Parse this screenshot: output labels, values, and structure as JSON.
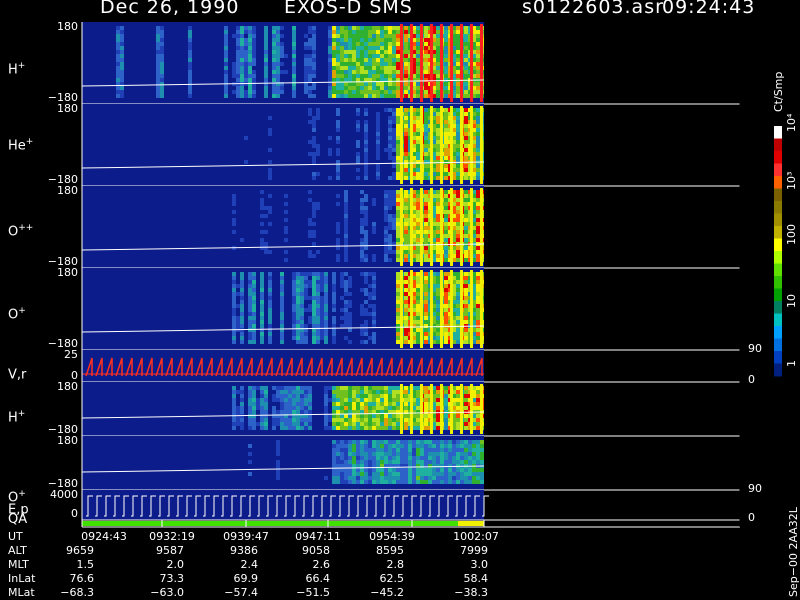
{
  "header": {
    "date": "Dec 26, 1990",
    "instrument": "EXOS-D SMS",
    "file": "s0122603.asr",
    "time": "09:24:43"
  },
  "panels": [
    {
      "label": "H",
      "sup": "+",
      "ymax": "180",
      "ymin": "−180"
    },
    {
      "label": "He",
      "sup": "+",
      "ymax": "180",
      "ymin": "−180"
    },
    {
      "label": "O",
      "sup": "++",
      "ymax": "180",
      "ymin": "−180"
    },
    {
      "label": "O",
      "sup": "+",
      "ymax": "180",
      "ymin": "−180"
    },
    {
      "label": "V,r",
      "sup": "",
      "ymax": "25",
      "ymin": "0",
      "rmax": "90",
      "rmin": "0"
    },
    {
      "label": "H",
      "sup": "+",
      "ymax": "180",
      "ymin": "−180"
    },
    {
      "label": "O",
      "sup": "+",
      "ymax": "180",
      "ymin": "−180"
    },
    {
      "label": "E,p",
      "sup": "",
      "ymax": "4000",
      "ymin": "0",
      "rmax": "90",
      "rmin": "0"
    }
  ],
  "qa_label": "QA",
  "colorbar": {
    "title": "Ct/Smp",
    "ticks": [
      "10⁴",
      "10³",
      "100",
      "10",
      "1"
    ],
    "colors": [
      "#ffffff",
      "#c00000",
      "#e00000",
      "#ff3030",
      "#ff6000",
      "#7a6000",
      "#8a7a00",
      "#a09000",
      "#c0b000",
      "#ffff00",
      "#b0ff00",
      "#60e000",
      "#30c000",
      "#00a000",
      "#008060",
      "#00c0c0",
      "#00a0ff",
      "#0070e0",
      "#0040c0",
      "#002080"
    ]
  },
  "chart_data": {
    "type": "heatmap",
    "title": "Dec 26, 1990   EXOS-D SMS",
    "x_ticks": [
      "0924:43",
      "0932:19",
      "0939:47",
      "0947:11",
      "0954:39",
      "1002:07"
    ],
    "ephemeris": {
      "labels": [
        "UT",
        "ALT",
        "MLT",
        "InLat",
        "MLat"
      ],
      "rows": {
        "ALT": [
          "9659",
          "9587",
          "9386",
          "9058",
          "8595",
          "7999"
        ],
        "MLT": [
          "1.5",
          "2.0",
          "2.4",
          "2.6",
          "2.8",
          "3.0"
        ],
        "InLat": [
          "76.6",
          "73.3",
          "69.9",
          "66.4",
          "62.5",
          "58.4"
        ],
        "MLat": [
          "−68.3",
          "−63.0",
          "−57.4",
          "−51.5",
          "−45.2",
          "−38.3"
        ]
      }
    },
    "colorbar_scale": "log",
    "colorbar_range": [
      1,
      10000
    ]
  },
  "footer": "Sep−00  2AA32L"
}
